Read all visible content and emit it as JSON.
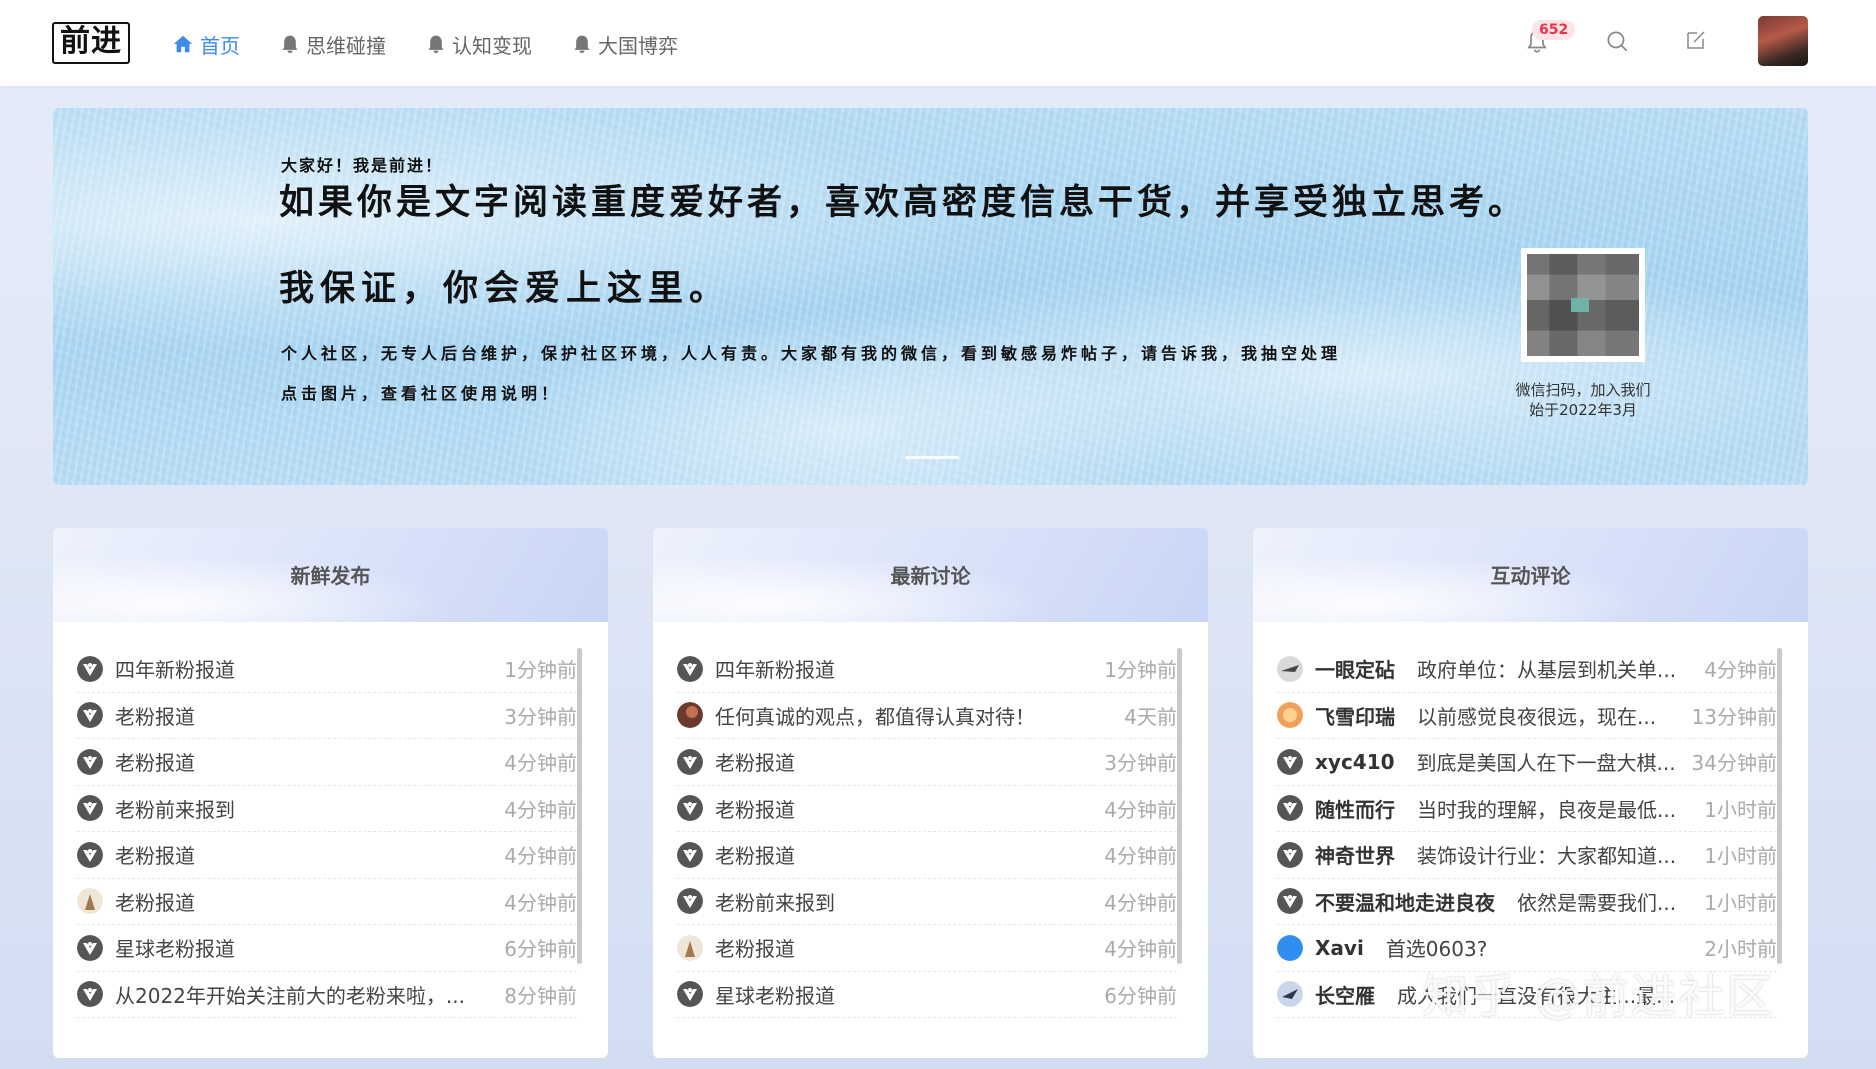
{
  "header": {
    "logo": "前进",
    "nav": [
      {
        "label": "首页",
        "icon": "home-icon",
        "active": true
      },
      {
        "label": "思维碰撞",
        "icon": "bell-icon",
        "active": false
      },
      {
        "label": "认知变现",
        "icon": "bell-icon",
        "active": false
      },
      {
        "label": "大国博弈",
        "icon": "bell-icon",
        "active": false
      }
    ],
    "notification_count": "652",
    "accent_color": "#3f8be8"
  },
  "banner": {
    "greeting": "大家好！我是前进！",
    "line1": "如果你是文字阅读重度爱好者，喜欢高密度信息干货，并享受独立思考。",
    "line2": "我保证，你会爱上这里。",
    "line3": "个人社区，无专人后台维护，保护社区环境，人人有责。大家都有我的微信，看到敏感易炸帖子，请告诉我，我抽空处理",
    "line4": "点击图片，查看社区使用说明！",
    "qr_caption_1": "微信扫码，加入我们",
    "qr_caption_2": "始于2022年3月"
  },
  "cards": {
    "fresh": {
      "title": "新鲜发布",
      "items": [
        {
          "text": "四年新粉报道",
          "time": "1分钟前",
          "avatar": "default"
        },
        {
          "text": "老粉报道",
          "time": "3分钟前",
          "avatar": "default"
        },
        {
          "text": "老粉报道",
          "time": "4分钟前",
          "avatar": "default"
        },
        {
          "text": "老粉前来报到",
          "time": "4分钟前",
          "avatar": "default"
        },
        {
          "text": "老粉报道",
          "time": "4分钟前",
          "avatar": "default"
        },
        {
          "text": "老粉报道",
          "time": "4分钟前",
          "avatar": "figure"
        },
        {
          "text": "星球老粉报道",
          "time": "6分钟前",
          "avatar": "default"
        },
        {
          "text": "从2022年开始关注前大的老粉来啦，...",
          "time": "8分钟前",
          "avatar": "default"
        }
      ]
    },
    "discuss": {
      "title": "最新讨论",
      "items": [
        {
          "text": "四年新粉报道",
          "time": "1分钟前",
          "avatar": "default"
        },
        {
          "text": "任何真诚的观点，都值得认真对待！",
          "time": "4天前",
          "avatar": "photo"
        },
        {
          "text": "老粉报道",
          "time": "3分钟前",
          "avatar": "default"
        },
        {
          "text": "老粉报道",
          "time": "4分钟前",
          "avatar": "default"
        },
        {
          "text": "老粉报道",
          "time": "4分钟前",
          "avatar": "default"
        },
        {
          "text": "老粉前来报到",
          "time": "4分钟前",
          "avatar": "default"
        },
        {
          "text": "老粉报道",
          "time": "4分钟前",
          "avatar": "figure"
        },
        {
          "text": "星球老粉报道",
          "time": "6分钟前",
          "avatar": "default"
        }
      ]
    },
    "comments": {
      "title": "互动评论",
      "items": [
        {
          "user": "一眼定砧",
          "text": "政府单位：从基层到机关单...",
          "time": "4分钟前",
          "avatar": "plane"
        },
        {
          "user": "飞雪印瑞",
          "text": "以前感觉良夜很远，现在...",
          "time": "13分钟前",
          "avatar": "orange"
        },
        {
          "user": "xyc410",
          "text": "到底是美国人在下一盘大棋...",
          "time": "34分钟前",
          "avatar": "default"
        },
        {
          "user": "随性而行",
          "text": "当时我的理解，良夜是最低...",
          "time": "1小时前",
          "avatar": "default"
        },
        {
          "user": "神奇世界",
          "text": "装饰设计行业：大家都知道...",
          "time": "1小时前",
          "avatar": "default"
        },
        {
          "user": "不要温和地走进良夜",
          "text": "依然是需要我们...",
          "time": "1小时前",
          "avatar": "default"
        },
        {
          "user": "Xavi",
          "text": "首选0603?",
          "time": "2小时前",
          "avatar": "blue"
        },
        {
          "user": "长空雁",
          "text": "成人我们一直没有很大主...最...",
          "time": "",
          "avatar": "bird"
        }
      ]
    }
  },
  "watermark": "知乎 @前进社区"
}
